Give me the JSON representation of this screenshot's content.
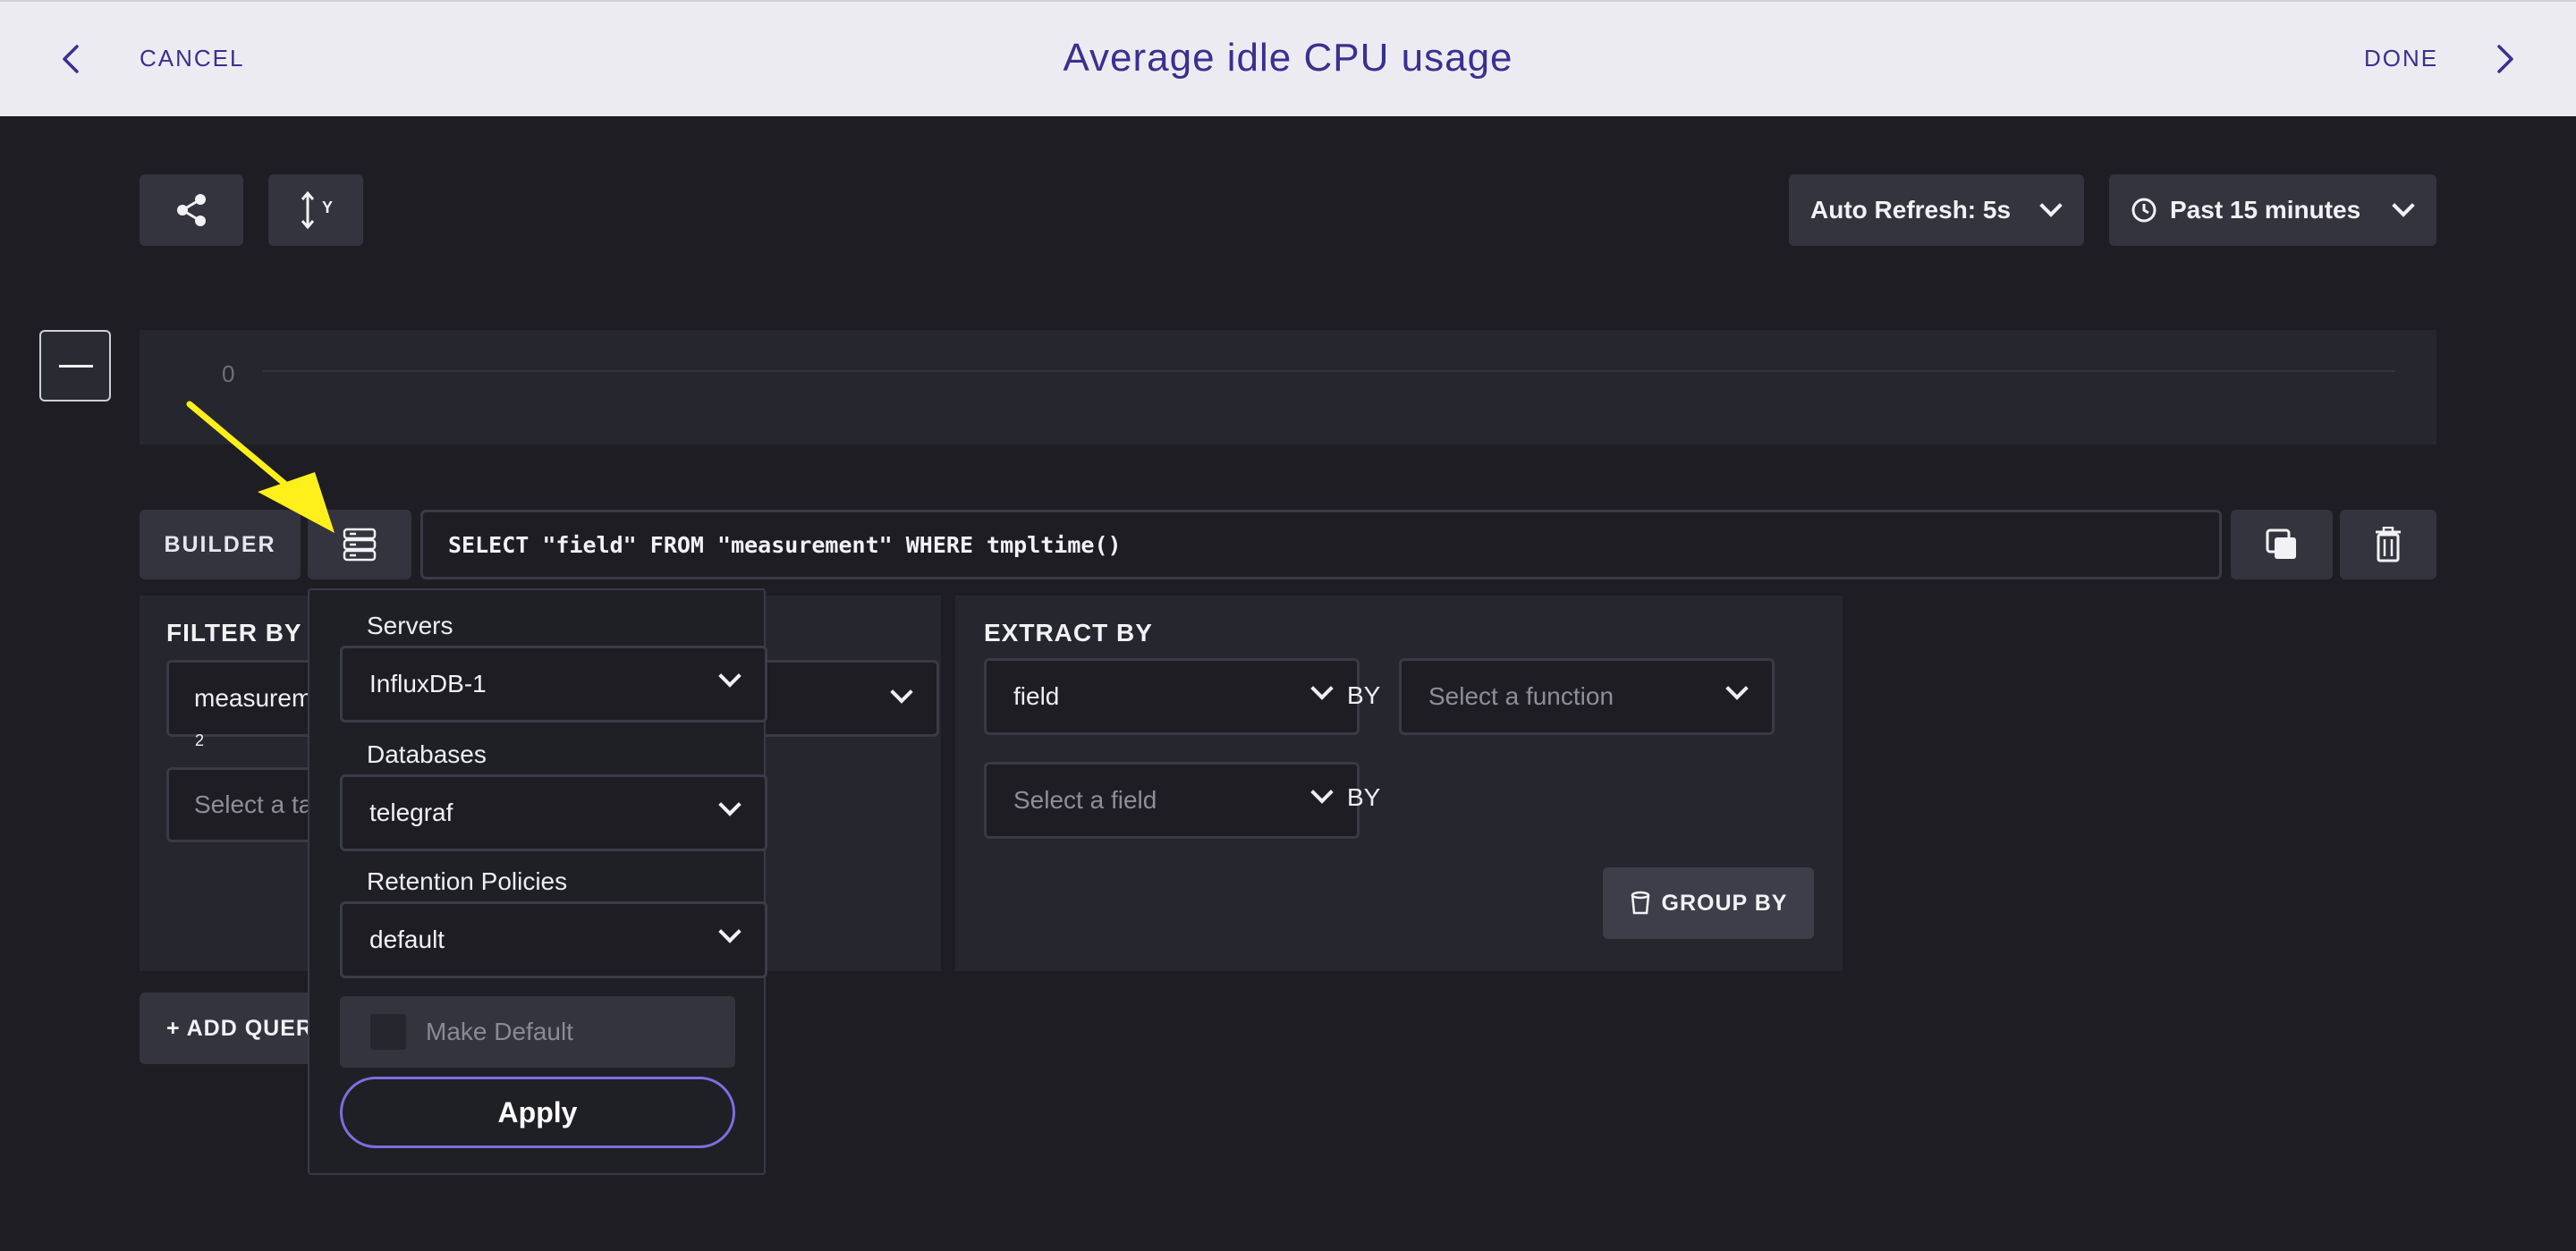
{
  "header": {
    "cancel_label": "CANCEL",
    "title": "Average idle CPU usage",
    "done_label": "DONE"
  },
  "toolbar": {
    "y_axis_label": "Y",
    "auto_refresh": "Auto Refresh: 5s",
    "time_range": "Past 15 minutes"
  },
  "graph": {
    "y_tick": "0"
  },
  "query": {
    "builder_label": "BUILDER",
    "text": "SELECT \"field\" FROM \"measurement\" WHERE tmpltime()"
  },
  "filter": {
    "title": "FILTER BY",
    "measurement_value": "measurem",
    "measurement_count": "2",
    "tag_placeholder": "Select a ta"
  },
  "extract": {
    "title": "EXTRACT BY",
    "field_value": "field",
    "by_label_1": "BY",
    "function_placeholder": "Select a function",
    "field_placeholder": "Select a field",
    "by_label_2": "BY",
    "group_by_label": "GROUP BY"
  },
  "add_query_label": "+ ADD QUER",
  "popover": {
    "servers_label": "Servers",
    "server_value": "InfluxDB-1",
    "databases_label": "Databases",
    "database_value": "telegraf",
    "retention_label": "Retention Policies",
    "retention_value": "default",
    "make_default_label": "Make Default",
    "apply_label": "Apply"
  },
  "colors": {
    "accent": "#3b2f8f",
    "apply_border": "#7b6fe0",
    "annotation_arrow": "#ffef1a"
  }
}
